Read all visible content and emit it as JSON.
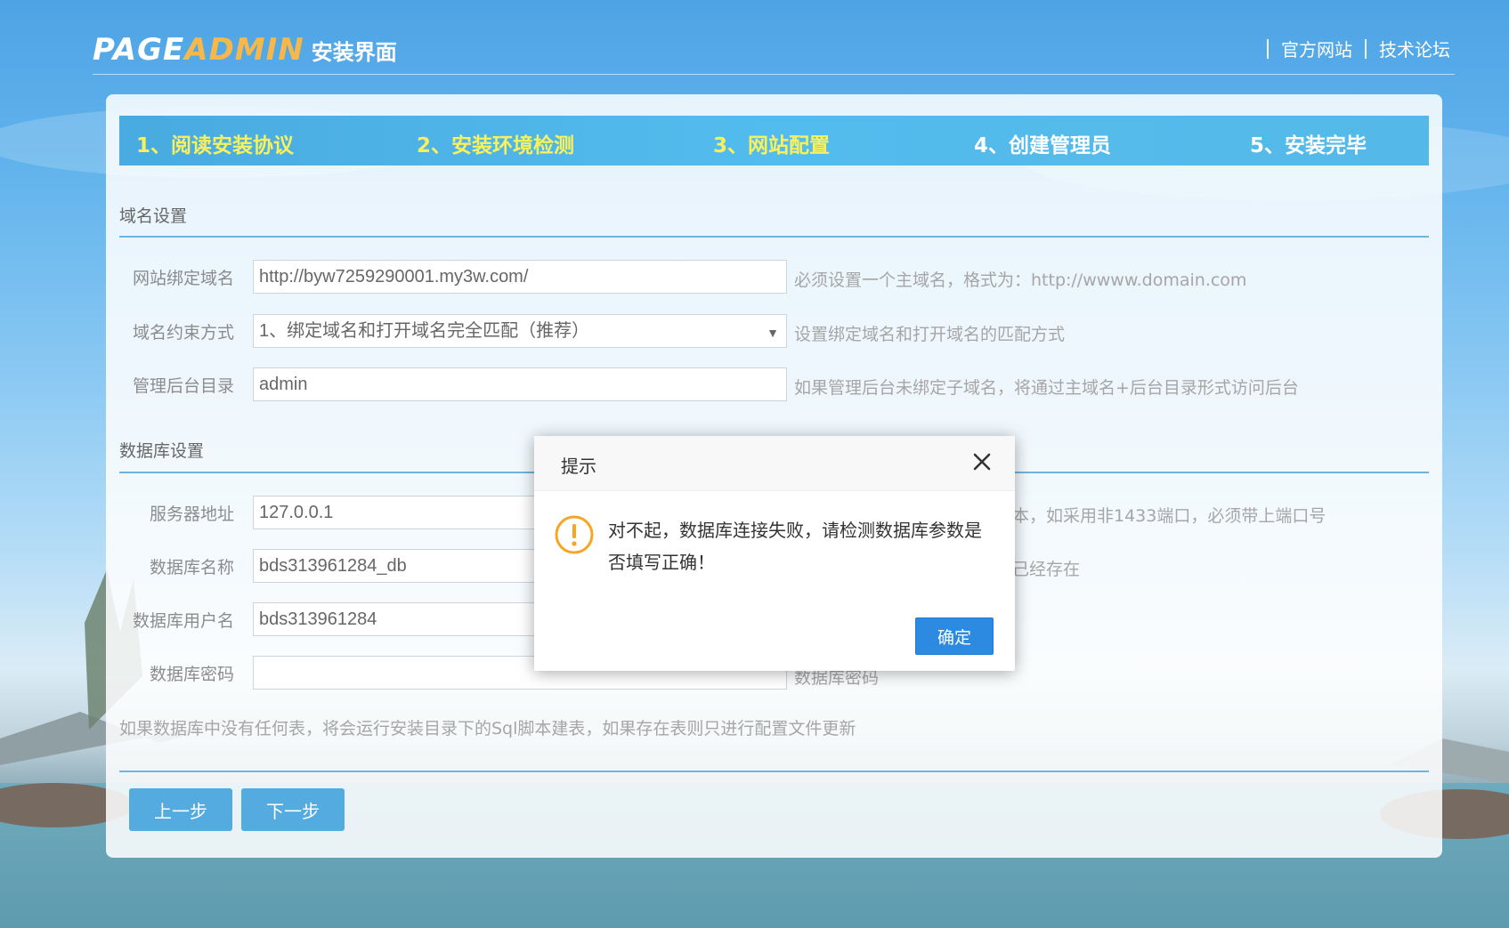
{
  "header": {
    "logo_page": "PAGE",
    "logo_admin": "ADMIN",
    "logo_sub": "安装界面",
    "links": [
      "官方网站",
      "技术论坛"
    ]
  },
  "steps": [
    {
      "label": "1、阅读安装协议",
      "done": true
    },
    {
      "label": "2、安装环境检测",
      "done": true
    },
    {
      "label": "3、网站配置",
      "done": true
    },
    {
      "label": "4、创建管理员",
      "done": false
    },
    {
      "label": "5、安装完毕",
      "done": false
    }
  ],
  "domain_section": {
    "title": "域名设置",
    "bind_domain": {
      "label": "网站绑定域名",
      "value": "http://byw7259290001.my3w.com/",
      "hint": "必须设置一个主域名，格式为：http://wwww.domain.com"
    },
    "constraint": {
      "label": "域名约束方式",
      "value": "1、绑定域名和打开域名完全匹配（推荐）",
      "hint": "设置绑定域名和打开域名的匹配方式"
    },
    "admin_dir": {
      "label": "管理后台目录",
      "value": "admin",
      "hint": "如果管理后台未绑定子域名，将通过主域名+后台目录形式访问后台"
    }
  },
  "db_section": {
    "title": "数据库设置",
    "server": {
      "label": "服务器地址",
      "value": "127.0.0.1",
      "hint": "本，如采用非1433端口，必须带上端口号"
    },
    "db_name": {
      "label": "数据库名称",
      "value": "bds313961284_db",
      "hint": "己经存在"
    },
    "db_user": {
      "label": "数据库用户名",
      "value": "bds313961284"
    },
    "db_pass": {
      "label": "数据库密码",
      "hint": "数据库密码"
    },
    "note": "如果数据库中没有任何表，将会运行安装目录下的Sql脚本建表，如果存在表则只进行配置文件更新"
  },
  "buttons": {
    "prev": "上一步",
    "next": "下一步"
  },
  "dialog": {
    "title": "提示",
    "message": "对不起，数据库连接失败，请检测数据库参数是否填写正确！",
    "ok": "确定"
  },
  "colors": {
    "accent": "#1b8fd4",
    "step_done": "#f7ec25",
    "warning": "#f5a623"
  }
}
